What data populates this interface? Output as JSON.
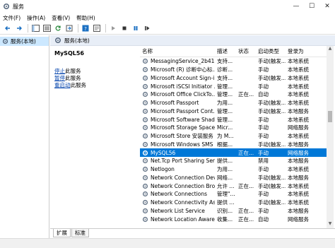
{
  "window": {
    "title": "服务",
    "minimize": "—",
    "maximize": "☐",
    "close": "✕"
  },
  "menu": [
    "文件(F)",
    "操作(A)",
    "查看(V)",
    "帮助(H)"
  ],
  "tree": {
    "root_label": "服务(本地)"
  },
  "header": {
    "label": "服务(本地)"
  },
  "detail": {
    "service_name": "MySQL56",
    "links": [
      {
        "text": "停止",
        "suffix": "此服务"
      },
      {
        "text": "暂停",
        "suffix": "此服务"
      },
      {
        "text": "重启动",
        "suffix": "此服务"
      }
    ]
  },
  "columns": [
    "名称",
    "描述",
    "状态",
    "启动类型",
    "登录为"
  ],
  "services": [
    {
      "name": "MessagingService_2b413...",
      "desc": "支持...",
      "status": "",
      "start": "手动(触发...",
      "login": "本地系统"
    },
    {
      "name": "Microsoft (R) 诊断中心标...",
      "desc": "诊断...",
      "status": "",
      "start": "手动",
      "login": "本地系统"
    },
    {
      "name": "Microsoft Account Sign-i...",
      "desc": "支持...",
      "status": "",
      "start": "手动(触发...",
      "login": "本地系统"
    },
    {
      "name": "Microsoft iSCSI Initiator ...",
      "desc": "管理...",
      "status": "",
      "start": "手动",
      "login": "本地系统"
    },
    {
      "name": "Microsoft Office ClickTo...",
      "desc": "管理...",
      "status": "正在...",
      "start": "自动",
      "login": "本地系统"
    },
    {
      "name": "Microsoft Passport",
      "desc": "为用...",
      "status": "",
      "start": "手动(触发...",
      "login": "本地系统"
    },
    {
      "name": "Microsoft Passport Cont...",
      "desc": "管理...",
      "status": "",
      "start": "手动(触发...",
      "login": "本地服务"
    },
    {
      "name": "Microsoft Software Shad...",
      "desc": "管理...",
      "status": "",
      "start": "手动",
      "login": "本地系统"
    },
    {
      "name": "Microsoft Storage Space...",
      "desc": "Micr...",
      "status": "",
      "start": "手动",
      "login": "网络服务"
    },
    {
      "name": "Microsoft Store 安装服务",
      "desc": "为 M...",
      "status": "",
      "start": "手动",
      "login": "本地系统"
    },
    {
      "name": "Microsoft Windows SMS ...",
      "desc": "根据...",
      "status": "",
      "start": "手动(触发...",
      "login": "本地服务"
    },
    {
      "name": "MySQL56",
      "desc": "",
      "status": "正在...",
      "start": "手动",
      "login": "网络服务",
      "selected": true
    },
    {
      "name": "Net.Tcp Port Sharing Ser...",
      "desc": "提供...",
      "status": "",
      "start": "禁用",
      "login": "本地服务"
    },
    {
      "name": "Netlogon",
      "desc": "为用...",
      "status": "",
      "start": "手动",
      "login": "本地系统"
    },
    {
      "name": "Network Connection Devi...",
      "desc": "网络...",
      "status": "",
      "start": "手动(触发...",
      "login": "本地服务"
    },
    {
      "name": "Network Connection Bro...",
      "desc": "允许 ...",
      "status": "正在...",
      "start": "手动(触发...",
      "login": "本地系统"
    },
    {
      "name": "Network Connections",
      "desc": "管理\"...",
      "status": "",
      "start": "手动",
      "login": "本地系统"
    },
    {
      "name": "Network Connectivity Ass...",
      "desc": "提供 ...",
      "status": "",
      "start": "手动(触发...",
      "login": "本地系统"
    },
    {
      "name": "Network List Service",
      "desc": "识别...",
      "status": "正在...",
      "start": "手动",
      "login": "本地服务"
    },
    {
      "name": "Network Location Aware...",
      "desc": "收集...",
      "status": "正在...",
      "start": "自动",
      "login": "网络服务"
    }
  ],
  "tabs": [
    "扩展",
    "标准"
  ]
}
